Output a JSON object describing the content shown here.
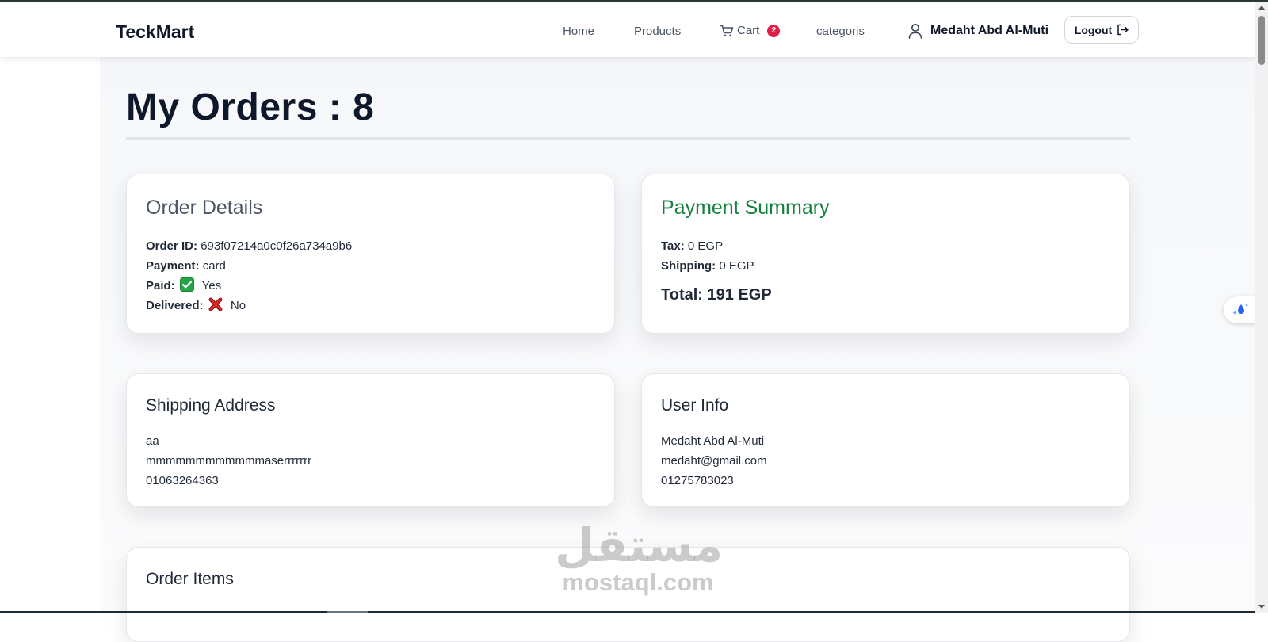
{
  "nav": {
    "brand": "TeckMart",
    "links": {
      "home": "Home",
      "products": "Products",
      "cart": "Cart",
      "categories": "categoris"
    },
    "cart_count": "2",
    "user_name": "Medaht Abd Al-Muti",
    "logout_label": "Logout"
  },
  "page": {
    "title": "My Orders : 8"
  },
  "order_details": {
    "heading": "Order Details",
    "order_id_label": "Order ID:",
    "order_id": "693f07214a0c0f26a734a9b6",
    "payment_label": "Payment:",
    "payment": "card",
    "paid_label": "Paid:",
    "paid": "Yes",
    "delivered_label": "Delivered:",
    "delivered": "No"
  },
  "payment_summary": {
    "heading": "Payment Summary",
    "tax_label": "Tax:",
    "tax": "0 EGP",
    "shipping_label": "Shipping:",
    "shipping": "0 EGP",
    "total": "Total: 191 EGP"
  },
  "shipping_address": {
    "heading": "Shipping Address",
    "line1": "aa",
    "line2": "mmmmmmmmmmmmaserrrrrrr",
    "line3": "01063264363"
  },
  "user_info": {
    "heading": "User Info",
    "name": "Medaht Abd Al-Muti",
    "email": "medaht@gmail.com",
    "phone": "01275783023"
  },
  "order_items": {
    "heading": "Order Items"
  },
  "watermark": {
    "arabic": "مستقل",
    "latin": "mostaql.com"
  },
  "colors": {
    "accent_green": "#15803d",
    "badge_red": "#e11d48",
    "title_dark": "#0f172a"
  }
}
